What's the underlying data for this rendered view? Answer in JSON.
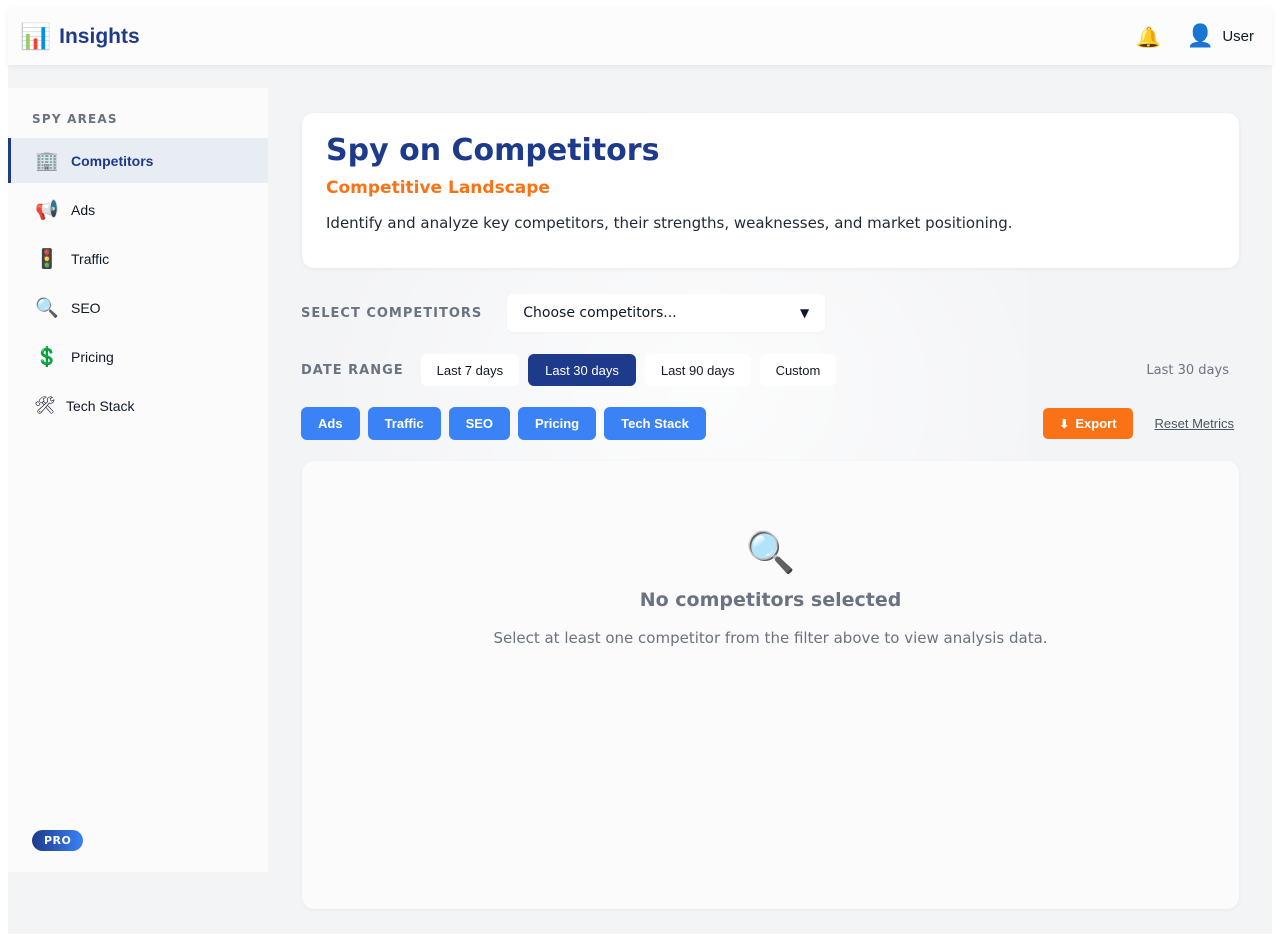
{
  "app": {
    "brand_icon": "📊",
    "title": "Insights"
  },
  "topbar": {
    "bell_icon": "🔔",
    "user_icon": "👤",
    "user_label": "User"
  },
  "sidebar": {
    "heading": "SPY AREAS",
    "items": [
      {
        "icon": "🏢",
        "label": "Competitors",
        "active": true
      },
      {
        "icon": "📢",
        "label": "Ads"
      },
      {
        "icon": "🚦",
        "label": "Traffic"
      },
      {
        "icon": "🔍",
        "label": "SEO"
      },
      {
        "icon": "💲",
        "label": "Pricing"
      },
      {
        "icon": "🛠",
        "label": "Tech Stack"
      }
    ],
    "badge": "PRO"
  },
  "header": {
    "title": "Spy on Competitors",
    "subtitle": "Competitive Landscape",
    "description": "Identify and analyze key competitors, their strengths, weaknesses, and market positioning."
  },
  "filters": {
    "competitors_label": "SELECT COMPETITORS",
    "competitors_placeholder": "Choose competitors...",
    "chevron": "▼",
    "date_label": "DATE RANGE",
    "date_options": [
      "Last 7 days",
      "Last 30 days",
      "Last 90 days",
      "Custom"
    ],
    "date_selected": "Last 30 days",
    "date_current": "Last 30 days"
  },
  "metrics": {
    "buttons": [
      "Ads",
      "Traffic",
      "SEO",
      "Pricing",
      "Tech Stack"
    ],
    "export_icon": "⬇",
    "export_label": "Export",
    "reset_label": "Reset Metrics"
  },
  "empty_state": {
    "icon": "🔍",
    "title": "No competitors selected",
    "text": "Select at least one competitor from the filter above to view analysis data."
  },
  "colors": {
    "brand": "#1e3a8a",
    "accent": "#f97316",
    "metric": "#3b82f6"
  }
}
